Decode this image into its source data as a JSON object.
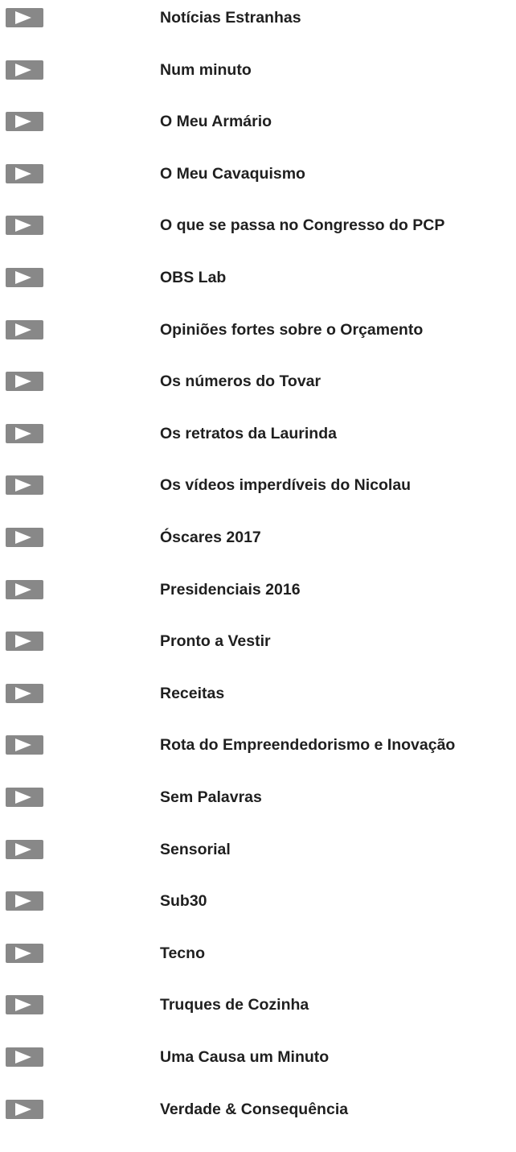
{
  "video_list": {
    "items": [
      {
        "title": "Notícias Estranhas",
        "icon": "play-icon"
      },
      {
        "title": "Num minuto",
        "icon": "play-icon"
      },
      {
        "title": "O Meu Armário",
        "icon": "play-icon"
      },
      {
        "title": "O Meu Cavaquismo",
        "icon": "play-icon"
      },
      {
        "title": "O que se passa no Congresso do PCP",
        "icon": "play-icon"
      },
      {
        "title": "OBS Lab",
        "icon": "play-icon"
      },
      {
        "title": "Opiniões fortes sobre o Orçamento",
        "icon": "play-icon"
      },
      {
        "title": "Os números do Tovar",
        "icon": "play-icon"
      },
      {
        "title": "Os retratos da Laurinda",
        "icon": "play-icon"
      },
      {
        "title": "Os vídeos imperdíveis do Nicolau",
        "icon": "play-icon"
      },
      {
        "title": "Óscares 2017",
        "icon": "play-icon"
      },
      {
        "title": "Presidenciais 2016",
        "icon": "play-icon"
      },
      {
        "title": "Pronto a Vestir",
        "icon": "play-icon"
      },
      {
        "title": "Receitas",
        "icon": "play-icon"
      },
      {
        "title": "Rota do Empreendedorismo e Inovação",
        "icon": "play-icon"
      },
      {
        "title": "Sem Palavras",
        "icon": "play-icon"
      },
      {
        "title": "Sensorial",
        "icon": "play-icon"
      },
      {
        "title": "Sub30",
        "icon": "play-icon"
      },
      {
        "title": "Tecno",
        "icon": "play-icon"
      },
      {
        "title": "Truques de Cozinha",
        "icon": "play-icon"
      },
      {
        "title": "Uma Causa um Minuto",
        "icon": "play-icon"
      },
      {
        "title": "Verdade & Consequência",
        "icon": "play-icon"
      }
    ]
  },
  "colors": {
    "play_button_bg": "#888888",
    "play_icon": "#ffffff",
    "title_text": "#1f1f1f"
  }
}
